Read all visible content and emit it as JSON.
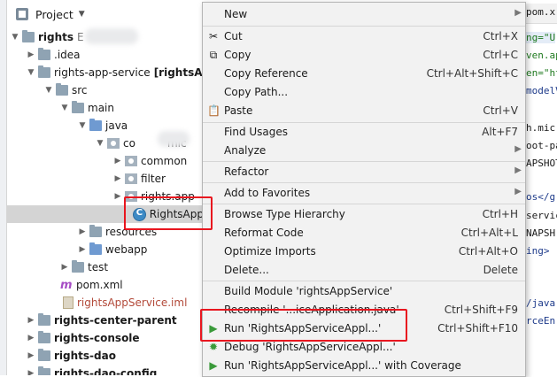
{
  "project_panel": {
    "title": "Project",
    "tree": [
      {
        "label": "rights",
        "suffix": "E",
        "bold": true
      },
      {
        "label": ".idea"
      },
      {
        "label": "rights-app-service",
        "suffix": "[rightsA",
        "bold": true
      },
      {
        "label": "src"
      },
      {
        "label": "main"
      },
      {
        "label": "java"
      },
      {
        "label": "co",
        "suffix": "mic"
      },
      {
        "label": "common"
      },
      {
        "label": "filter"
      },
      {
        "label": "rights.app"
      },
      {
        "label": "RightsApp"
      },
      {
        "label": "resources"
      },
      {
        "label": "webapp"
      },
      {
        "label": "test"
      },
      {
        "label": "pom.xml"
      },
      {
        "label": "rightsAppService.iml"
      },
      {
        "label": "rights-center-parent"
      },
      {
        "label": "rights-console"
      },
      {
        "label": "rights-dao"
      },
      {
        "label": "rights-dao-config"
      }
    ]
  },
  "code_fragments": [
    "pom.x",
    "ng=\"U",
    "ven.ap",
    "en=\"ht",
    "modelV",
    "h.mic",
    "oot-pa",
    "APSHOT",
    "os</g",
    "servic",
    "NAPSH",
    "ing>",
    "/java",
    "rceEn"
  ],
  "context_menu": {
    "items": [
      {
        "label": "New",
        "shortcut": "",
        "submenu": true
      },
      {
        "label": "Cut",
        "shortcut": "Ctrl+X",
        "icon": "cut-icon"
      },
      {
        "label": "Copy",
        "shortcut": "Ctrl+C",
        "icon": "copy-icon"
      },
      {
        "label": "Copy Reference",
        "shortcut": "Ctrl+Alt+Shift+C"
      },
      {
        "label": "Copy Path...",
        "shortcut": ""
      },
      {
        "label": "Paste",
        "shortcut": "Ctrl+V",
        "icon": "paste-icon"
      },
      {
        "label": "Find Usages",
        "shortcut": "Alt+F7"
      },
      {
        "label": "Analyze",
        "shortcut": "",
        "submenu": true
      },
      {
        "label": "Refactor",
        "shortcut": "",
        "submenu": true
      },
      {
        "label": "Add to Favorites",
        "shortcut": "",
        "submenu": true
      },
      {
        "label": "Browse Type Hierarchy",
        "shortcut": "Ctrl+H"
      },
      {
        "label": "Reformat Code",
        "shortcut": "Ctrl+Alt+L"
      },
      {
        "label": "Optimize Imports",
        "shortcut": "Ctrl+Alt+O"
      },
      {
        "label": "Delete...",
        "shortcut": "Delete"
      },
      {
        "label": "Build Module 'rightsAppService'",
        "shortcut": ""
      },
      {
        "label": "Recompile '...iceApplication.java'",
        "shortcut": "Ctrl+Shift+F9"
      },
      {
        "label": "Run 'RightsAppServiceAppl...'",
        "shortcut": "Ctrl+Shift+F10",
        "icon": "run-icon"
      },
      {
        "label": "Debug 'RightsAppServiceAppl...'",
        "shortcut": "",
        "icon": "debug-icon"
      },
      {
        "label": "Run 'RightsAppServiceAppl...' with Coverage",
        "shortcut": "",
        "icon": "coverage-icon"
      }
    ]
  },
  "colors": {
    "highlight": "#e8161f",
    "menu_bg": "#f2f2f2",
    "run_green": "#3a9a3a"
  }
}
